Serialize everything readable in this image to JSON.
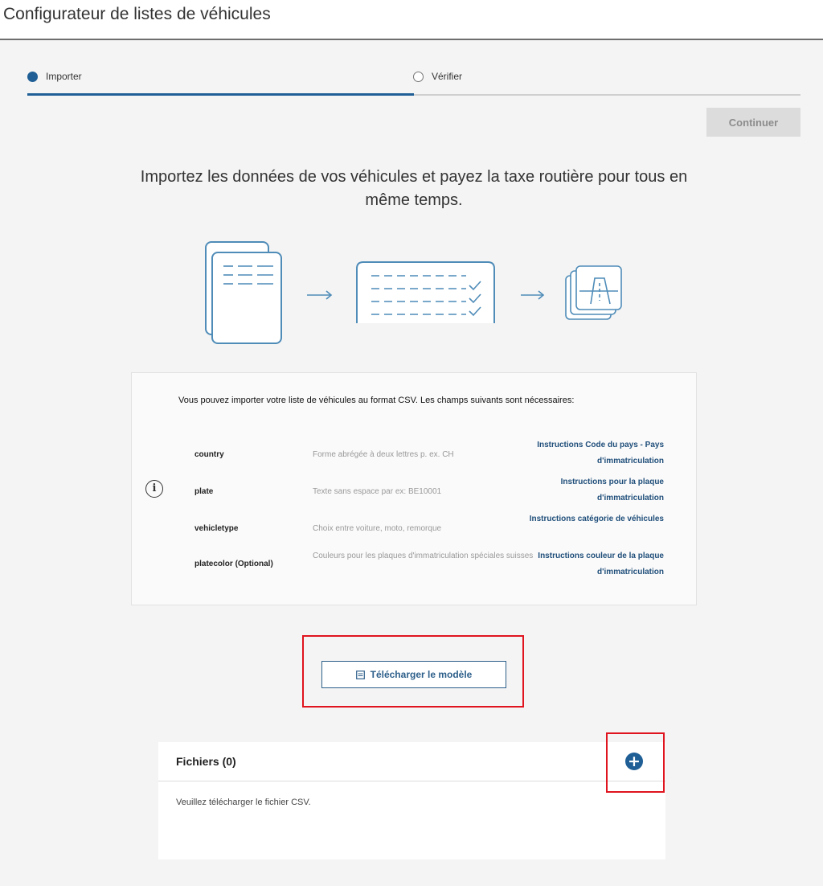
{
  "app": {
    "title": "Configurateur de listes de véhicules"
  },
  "stepper": {
    "steps": [
      {
        "label": "Importer",
        "active": true
      },
      {
        "label": "Vérifier",
        "active": false
      }
    ]
  },
  "toolbar": {
    "continue_label": "Continuer"
  },
  "headline": "Importez les données de vos véhicules et payez la taxe routière pour tous en même temps.",
  "info": {
    "icon": "info-icon",
    "intro": "Vous pouvez importer votre liste de véhicules au format CSV. Les champs suivants sont nécessaires:",
    "fields": [
      {
        "name": "country",
        "description": "Forme abrégée à deux lettres p. ex. CH",
        "link": "Instructions Code du pays - Pays d'immatriculation"
      },
      {
        "name": "plate",
        "description": "Texte sans espace par ex: BE10001",
        "link": "Instructions pour la plaque d'immatriculation"
      },
      {
        "name": "vehicletype",
        "description": "Choix entre voiture, moto, remorque",
        "link": "Instructions catégorie de véhicules"
      },
      {
        "name": "platecolor (Optional)",
        "description": "Couleurs pour les plaques d'immatriculation spéciales suisses",
        "link": "Instructions couleur de la plaque d'immatriculation"
      }
    ]
  },
  "download": {
    "label": "Télécharger le modèle",
    "icon": "file-icon"
  },
  "files": {
    "title": "Fichiers (0)",
    "empty_message": "Veuillez télécharger le fichier CSV.",
    "add_icon": "plus-circle-icon"
  },
  "colors": {
    "accent": "#1f5f96",
    "highlight": "#e0141e",
    "link": "#1f4e7a",
    "illustration": "#4f8cb8"
  }
}
